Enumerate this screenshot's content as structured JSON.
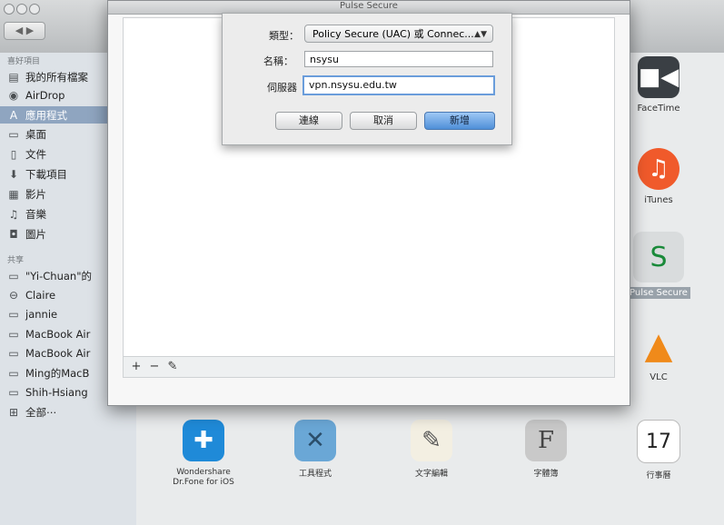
{
  "finder": {
    "sidebar": {
      "favorites_header": "喜好項目",
      "shared_header": "共享",
      "favorites": [
        {
          "label": "我的所有檔案",
          "icon": "all-files-icon"
        },
        {
          "label": "AirDrop",
          "icon": "airdrop-icon"
        },
        {
          "label": "應用程式",
          "icon": "applications-icon",
          "selected": true
        },
        {
          "label": "桌面",
          "icon": "desktop-icon"
        },
        {
          "label": "文件",
          "icon": "documents-icon"
        },
        {
          "label": "下載項目",
          "icon": "downloads-icon"
        },
        {
          "label": "影片",
          "icon": "movies-icon"
        },
        {
          "label": "音樂",
          "icon": "music-icon"
        },
        {
          "label": "圖片",
          "icon": "pictures-icon"
        }
      ],
      "shared": [
        {
          "label": "\"Yi-Chuan\"的",
          "icon": "computer-icon"
        },
        {
          "label": "Claire",
          "icon": "shared-disk-icon"
        },
        {
          "label": "jannie",
          "icon": "computer-icon"
        },
        {
          "label": "MacBook Air",
          "icon": "computer-icon"
        },
        {
          "label": "MacBook Air",
          "icon": "computer-icon"
        },
        {
          "label": "Ming的MacB",
          "icon": "computer-icon"
        },
        {
          "label": "Shih-Hsiang",
          "icon": "computer-icon"
        },
        {
          "label": "全部⋯",
          "icon": "network-icon"
        }
      ]
    },
    "apps_right": [
      {
        "label": "FaceTime",
        "icon": "facetime-icon",
        "color": "#3a3f44"
      },
      {
        "label": "iTunes",
        "icon": "itunes-icon",
        "color": "#f05a2b"
      },
      {
        "label": "Pulse Secure",
        "icon": "pulse-secure-icon",
        "color": "#d9dcdd",
        "selected": true
      },
      {
        "label": "VLC",
        "icon": "vlc-icon",
        "color": "#ffffff"
      }
    ],
    "apps_bottom": [
      {
        "label": "Wondershare Dr.Fone for iOS",
        "icon": "drfone-icon",
        "color": "#1f8ad8"
      },
      {
        "label": "工具程式",
        "icon": "utilities-folder-icon",
        "color": "#6aa7d6"
      },
      {
        "label": "文字編輯",
        "icon": "textedit-icon",
        "color": "#f3efe2"
      },
      {
        "label": "字體簿",
        "icon": "fontbook-icon",
        "color": "#c9c9c9"
      },
      {
        "label": "行事曆",
        "icon": "calendar-icon",
        "color": "#ffffff",
        "day": "17"
      }
    ]
  },
  "pulse": {
    "title": "Pulse Secure",
    "toolbar": {
      "add": "+",
      "remove": "−",
      "edit": "✎"
    }
  },
  "dialog": {
    "type_label": "類型：",
    "type_value": "Policy Secure (UAC) 或 Connec...",
    "name_label": "名稱：",
    "name_value": "nsysu",
    "server_label": "伺服器",
    "server_value": "vpn.nsysu.edu.tw",
    "connect_button": "連線",
    "cancel_button": "取消",
    "add_button": "新增"
  },
  "colors": {
    "accent": "#4f8fd8",
    "sidebar_selected": "#8fa5c0"
  }
}
